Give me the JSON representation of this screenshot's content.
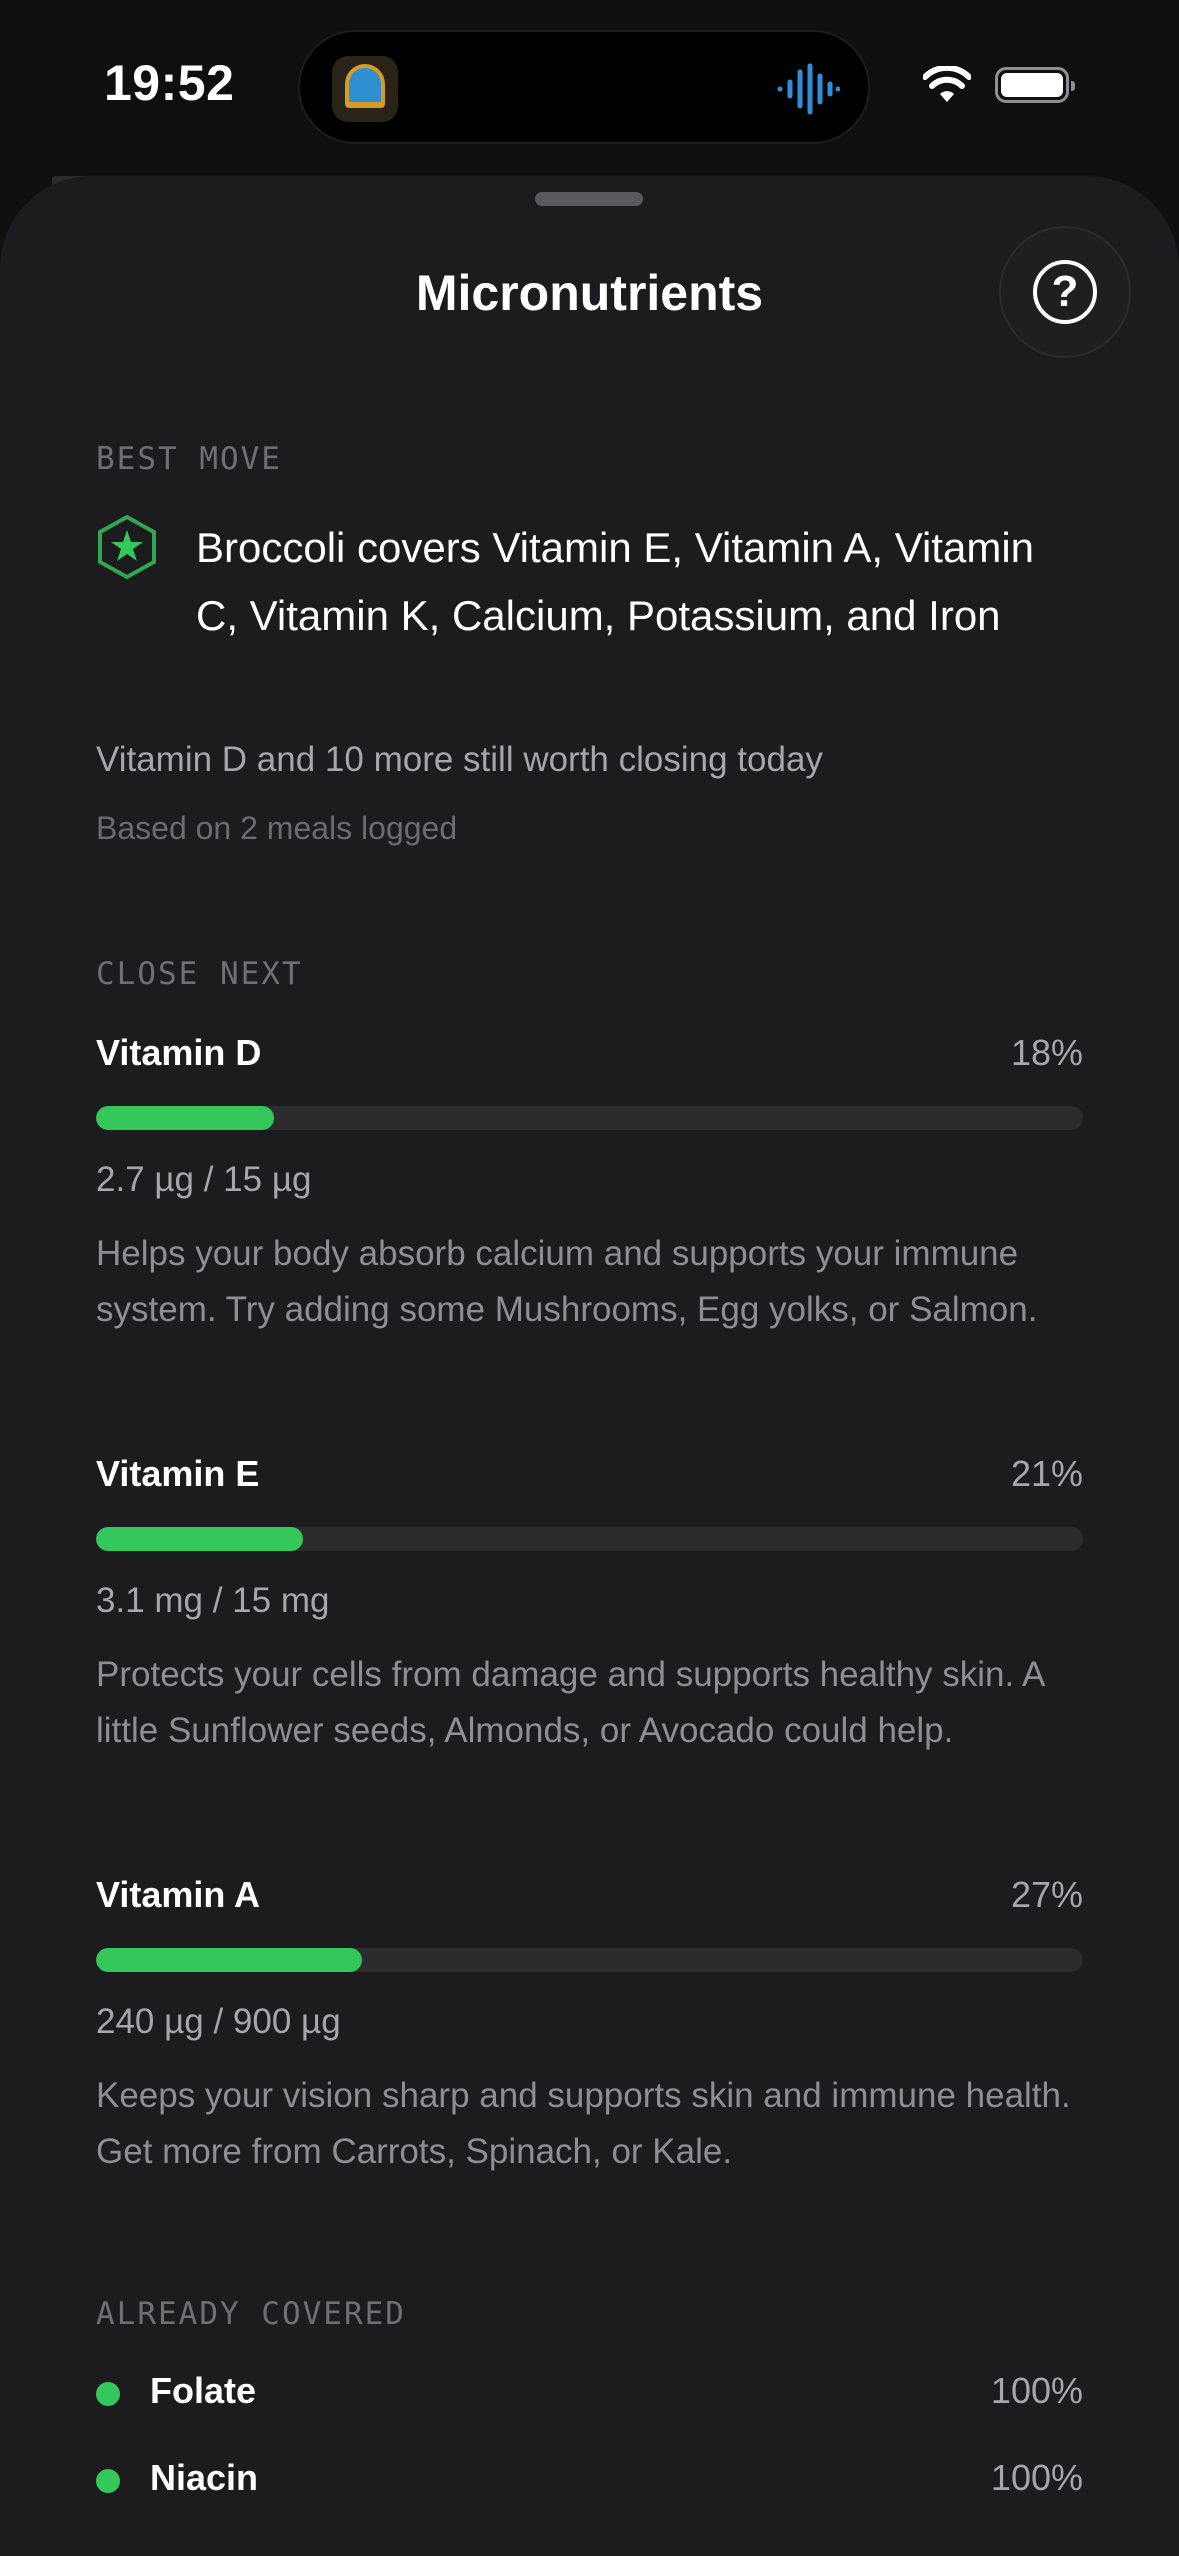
{
  "status_bar": {
    "time": "19:52",
    "wifi_icon": "wifi-icon",
    "battery_icon": "battery-icon"
  },
  "sheet": {
    "title": "Micronutrients",
    "help_icon": "?"
  },
  "best_move": {
    "section_label": "BEST MOVE",
    "icon": "star-badge-icon",
    "text": "Broccoli covers Vitamin E, Vitamin A, Vitamin C, Vitamin K, Calcium, Potassium, and Iron"
  },
  "summary": {
    "text": "Vitamin D and 10 more still worth closing today",
    "subtext": "Based on 2 meals logged"
  },
  "close_next": {
    "section_label": "CLOSE NEXT",
    "items": [
      {
        "name": "Vitamin D",
        "percent_label": "18%",
        "progress": 0.18,
        "amount": "2.7 µg / 15 µg",
        "description": "Helps your body absorb calcium and supports your immune system. Try adding some Mushrooms, Egg yolks, or Salmon."
      },
      {
        "name": "Vitamin E",
        "percent_label": "21%",
        "progress": 0.21,
        "amount": "3.1 mg / 15 mg",
        "description": "Protects your cells from damage and supports healthy skin. A little Sunflower seeds, Almonds, or Avocado could help."
      },
      {
        "name": "Vitamin A",
        "percent_label": "27%",
        "progress": 0.27,
        "amount": "240 µg / 900 µg",
        "description": "Keeps your vision sharp and supports skin and immune health. Get more from Carrots, Spinach, or Kale."
      }
    ]
  },
  "already_covered": {
    "section_label": "ALREADY COVERED",
    "items": [
      {
        "name": "Folate",
        "percent_label": "100%"
      },
      {
        "name": "Niacin",
        "percent_label": "100%"
      }
    ]
  },
  "colors": {
    "accent_green": "#34c759",
    "sheet_bg": "#1c1c1e",
    "track": "#2c2c2e"
  }
}
